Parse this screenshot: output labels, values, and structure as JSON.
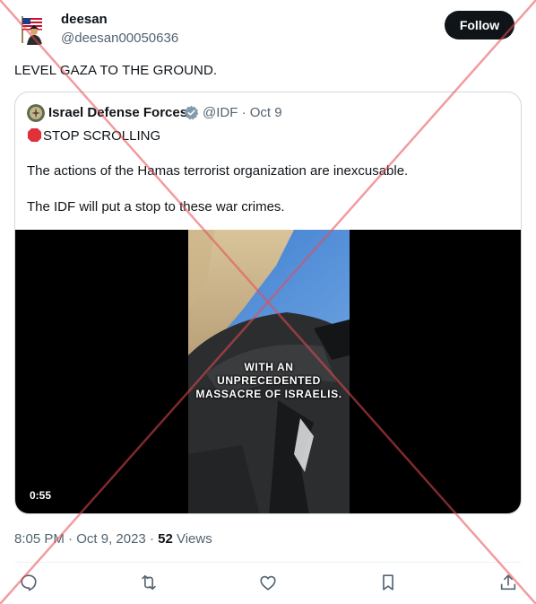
{
  "tweet": {
    "author_name": "deesan",
    "author_handle": "@deesan00050636",
    "follow_label": "Follow",
    "text": "LEVEL GAZA TO THE GROUND.",
    "time": "8:05 PM",
    "date": "Oct 9, 2023",
    "views_count": "52",
    "views_label": "Views"
  },
  "quoted": {
    "author_name": "Israel Defense Forces",
    "author_handle": "@IDF",
    "date": "Oct 9",
    "line1": "STOP SCROLLING",
    "line2": "The actions of the Hamas terrorist organization are inexcusable.",
    "line3": "The IDF will put a stop to these war crimes.",
    "video": {
      "caption_lines": [
        "WITH AN",
        "UNPRECEDENTED",
        "MASSACRE OF ISRAELIS."
      ],
      "duration": "0:55"
    }
  },
  "icons": {
    "verified": "verified-badge-icon",
    "stop_sign": "stop-sign-emoji",
    "actions": [
      "reply-icon",
      "retweet-icon",
      "like-icon",
      "bookmark-icon",
      "share-icon"
    ]
  },
  "colors": {
    "follow_bg": "#0f1419",
    "muted_text": "#536471",
    "verified_gray": "#829aab",
    "watermark_red": "#e84b52"
  }
}
